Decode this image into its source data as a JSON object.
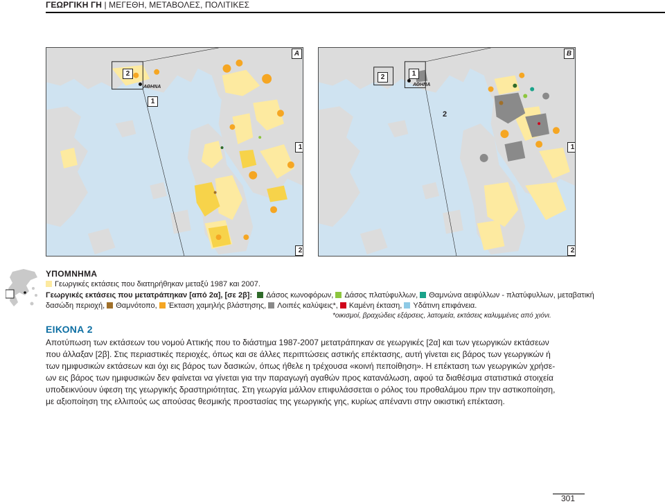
{
  "header": {
    "chapter": "ΓΕΩΡΓΙΚΗ ΓΗ",
    "separator": "|",
    "subtitle": "ΜΕΓΕΘΗ, ΜΕΤΑΒΟΛΕΣ, ΠΟΛΙΤΙΚΕΣ"
  },
  "map_a": {
    "letter": "A",
    "city": "ΑΘΗΝΑ",
    "zone_1": "1",
    "zone_2": "2"
  },
  "map_b": {
    "letter": "B",
    "city": "ΑΘΗΝΑ",
    "zone_1": "1",
    "zone_2": "2"
  },
  "legend": {
    "title": "ΥΠΟΜΝΗΜΑ",
    "row1": "Γεωργικές εκτάσεις που διατηρήθηκαν μεταξύ 1987 και 2007.",
    "row2_bold": "Γεωργικές εκτάσεις που μετατράπηκαν [από 2α], [σε 2β]:",
    "coniferous": "Δάσος κωνοφόρων,",
    "broadleaf": "Δάσος πλατύφυλλων,",
    "shrubs_evergreen": "Θαμνώνα αειφύλλων - πλατύφυλλων, μεταβατική",
    "row3_cont": "δασώδη περιοχή,",
    "shrubland": "Θαμνότοπο,",
    "low_veg": "Έκταση χαμηλής βλάστησης,",
    "other_cover": "Λοιπές καλύψεις*,",
    "burnt": "Καμένη έκταση,",
    "water": "Υδάτινη επιφάνεια.",
    "note": "*οικισμοί, βραχώδεις εξάρσεις, λατομεία, εκτάσεις καλυμμένες από χιόνι."
  },
  "colors": {
    "retained": "#fdeaa0",
    "coniferous": "#2f6b2a",
    "broadleaf": "#8dc63f",
    "shrubs_evergreen": "#1aa38a",
    "shrubland": "#a0702a",
    "low_veg": "#f5a623",
    "other_cover": "#8a8a8a",
    "burnt": "#d0021b",
    "water": "#8ecae6",
    "sea": "#cfe3f1",
    "land": "#dcdcdc",
    "agri_bright": "#f7d34a",
    "figure_title": "#0e6fa3"
  },
  "figure": {
    "title": "ΕΙΚΟΝΑ 2",
    "caption": [
      "Αποτύπωση των εκτάσεων του νομού Αττικής που το διάστημα 1987-2007 μετατράπηκαν σε γεωργικές [2α] και των γεωργικών εκτάσεων",
      "που άλλαξαν [2β]. Στις περιαστικές περιοχές, όπως και σε άλλες περιπτώσεις αστικής επέκτασης, αυτή γίνεται εις βάρος των γεωργικών ή",
      "των ημιφυσικών εκτάσεων και όχι εις βάρος των δασικών, όπως ήθελε η τρέχουσα «κοινή πεποίθηση». Η επέκταση των γεωργικών χρήσε-",
      "ων εις βάρος των ημιφυσικών δεν φαίνεται να γίνεται για την παραγωγή αγαθών προς κατανάλωση, αφού τα διαθέσιμα στατιστικά στοιχεία",
      "υποδεικνύουν ύφεση της γεωργικής δραστηριότητας. Στη γεωργία μάλλον επιφυλάσσεται ο ρόλος του προθαλάμου πριν την αστικοποίηση,",
      "με αξιοποίηση της ελλιπούς ως απούσας θεσμικής προστασίας της γεωργικής γης, κυρίως απέναντι στην οικιστική επέκταση."
    ]
  },
  "page_number": "301"
}
